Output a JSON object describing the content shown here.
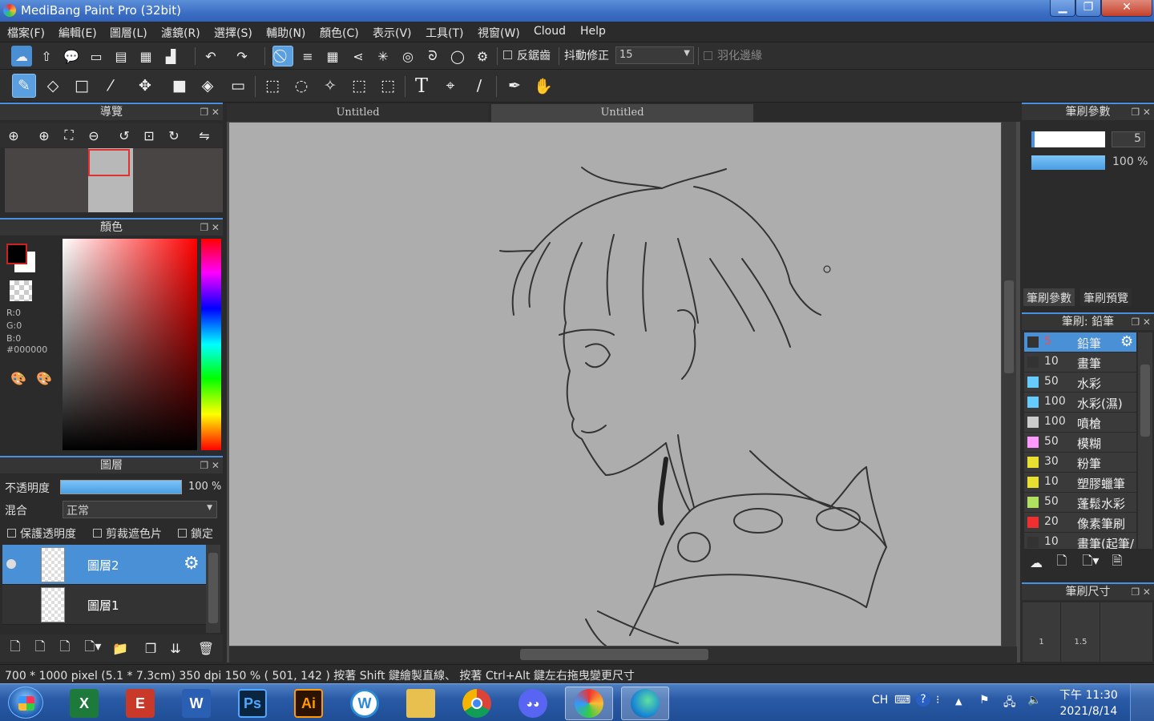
{
  "window": {
    "title": "MediBang Paint Pro (32bit)",
    "min": "▁",
    "max": "❐",
    "close": "✕"
  },
  "menu": [
    "檔案(F)",
    "編輯(E)",
    "圖層(L)",
    "濾鏡(R)",
    "選擇(S)",
    "輔助(N)",
    "顏色(C)",
    "表示(V)",
    "工具(T)",
    "視窗(W)",
    "Cloud",
    "Help"
  ],
  "toolbar1": {
    "antialias_label": "反鋸齒",
    "stabilizer_label": "抖動修正",
    "stabilizer_value": "15",
    "feather_label": "羽化邊緣"
  },
  "tabs": [
    "Untitled",
    "Untitled"
  ],
  "panels": {
    "navigator": "導覽",
    "color": "顏色",
    "layer": "圖層",
    "brush_param": "筆刷參數",
    "brush_pencil": "筆刷: 鉛筆",
    "brush_size": "筆刷尺寸"
  },
  "color": {
    "r": "R:0",
    "g": "G:0",
    "b": "B:0",
    "hex": "#000000",
    "fg": "#000000",
    "bg": "#ffffff"
  },
  "layer_panel": {
    "opacity_label": "不透明度",
    "opacity_value": "100 %",
    "opacity": 1.0,
    "blend_label": "混合",
    "blend_value": "正常",
    "protect_alpha": "保護透明度",
    "clipping": "剪裁遮色片",
    "lock": "鎖定",
    "layers": [
      {
        "name": "圖層2",
        "selected": true
      },
      {
        "name": "圖層1",
        "selected": false
      }
    ]
  },
  "brush_param": {
    "size_value": "5",
    "opacity_value": "100 %",
    "tab1": "筆刷參數",
    "tab2": "筆刷預覽"
  },
  "brushes": [
    {
      "size": "5",
      "name": "鉛筆",
      "color": "#333333"
    },
    {
      "size": "10",
      "name": "畫筆",
      "color": "#333333"
    },
    {
      "size": "50",
      "name": "水彩",
      "color": "#66ccff"
    },
    {
      "size": "100",
      "name": "水彩(濕)",
      "color": "#66ccff"
    },
    {
      "size": "100",
      "name": "噴槍",
      "color": "#cccccc"
    },
    {
      "size": "50",
      "name": "模糊",
      "color": "#ff99ff"
    },
    {
      "size": "30",
      "name": "粉筆",
      "color": "#e8e030"
    },
    {
      "size": "10",
      "name": "塑膠蠟筆",
      "color": "#e8e030"
    },
    {
      "size": "50",
      "name": "蓬鬆水彩",
      "color": "#b0e060"
    },
    {
      "size": "20",
      "name": "像素筆刷",
      "color": "#f03030"
    },
    {
      "size": "10",
      "name": "畫筆(起筆/",
      "color": "#333333"
    }
  ],
  "brush_sizes": [
    "1",
    "1.5"
  ],
  "status": "700 * 1000 pixel   (5.1 * 7.3cm)   350 dpi   150 %   ( 501, 142 )   按著 Shift 鍵繪製直線、 按著 Ctrl+Alt 鍵左右拖曳變更尺寸",
  "taskbar": {
    "apps": [
      {
        "name": "excel",
        "label": "X",
        "color": "#1e7a3a"
      },
      {
        "name": "access",
        "label": "E",
        "color": "#c8392a"
      },
      {
        "name": "word",
        "label": "W",
        "color": "#2b5fb4"
      },
      {
        "name": "photoshop",
        "label": "Ps",
        "color": "#0a2540"
      },
      {
        "name": "illustrator",
        "label": "Ai",
        "color": "#2b1300"
      },
      {
        "name": "webex",
        "label": "W",
        "color": "#ffffff"
      },
      {
        "name": "explorer",
        "label": "",
        "color": "#e8c050"
      },
      {
        "name": "chrome",
        "label": "",
        "color": "#ffffff"
      },
      {
        "name": "discord",
        "label": "",
        "color": "#5865f2"
      },
      {
        "name": "medibang",
        "label": "",
        "color": "#ffffff"
      },
      {
        "name": "edge",
        "label": "",
        "color": "#1a8ad4"
      }
    ],
    "ime": "CH",
    "time": "下午 11:30",
    "date": "2021/8/14"
  }
}
